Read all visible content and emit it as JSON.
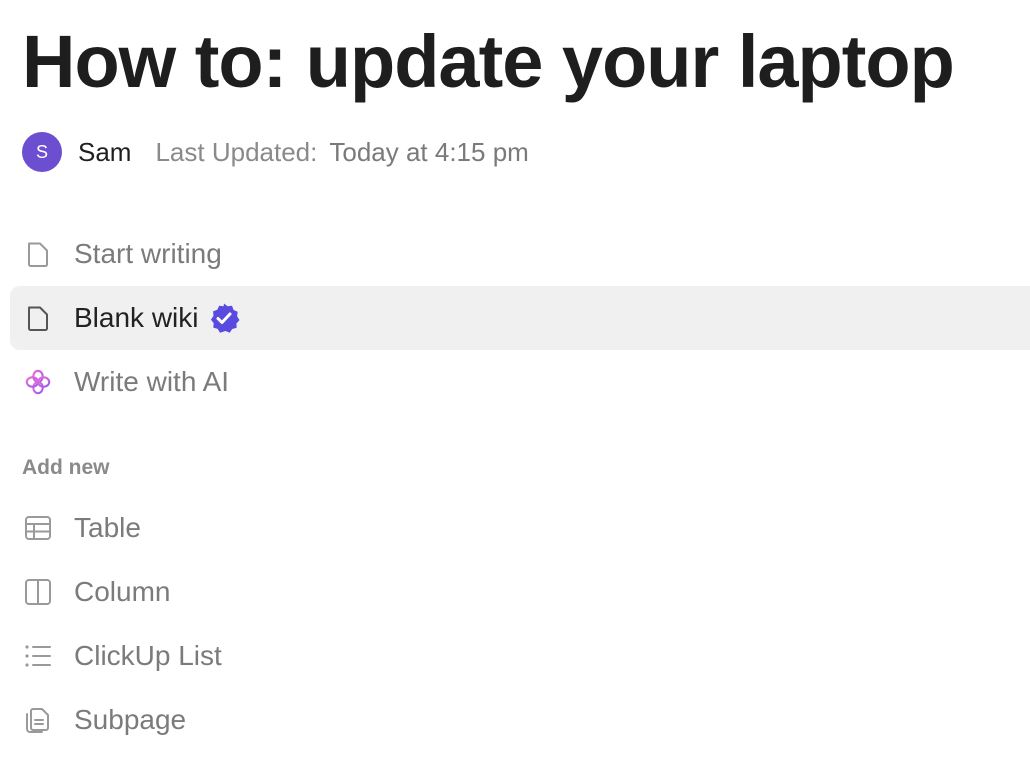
{
  "document": {
    "title": "How to: update your laptop"
  },
  "meta": {
    "avatar_initial": "S",
    "author": "Sam",
    "updated_label": "Last Updated:",
    "updated_value": "Today at 4:15 pm"
  },
  "templates": {
    "start_writing": "Start writing",
    "blank_wiki": "Blank wiki",
    "write_ai": "Write with AI"
  },
  "add_new": {
    "label": "Add new",
    "table": "Table",
    "column": "Column",
    "list": "ClickUp List",
    "subpage": "Subpage"
  },
  "colors": {
    "accent": "#5a4be0",
    "avatar": "#6b4fd0",
    "selected_bg": "#f0f0f0"
  }
}
